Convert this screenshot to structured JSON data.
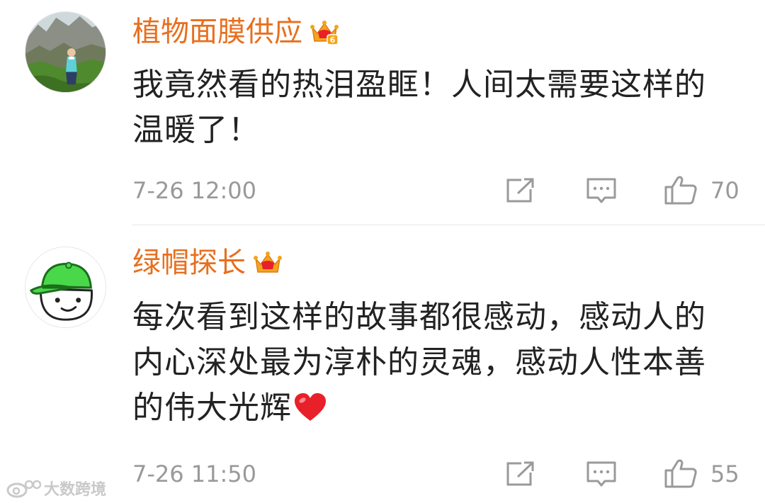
{
  "comments": [
    {
      "username": "植物面膜供应",
      "text": "我竟然看的热泪盈眶！人间太需要这样的温暖了！",
      "timestamp": "7-26 12:00",
      "likes": "70",
      "avatar_icon": "person-on-mountain-photo",
      "badge_icon": "vip-crown-level-6-icon",
      "badge_level": "6"
    },
    {
      "username": "绿帽探长",
      "text": "每次看到这样的故事都很感动，感动人的内心深处最为淳朴的灵魂，感动人性本善的伟大光辉",
      "trailing_emoji": "heart-icon",
      "timestamp": "7-26 11:50",
      "likes": "55",
      "avatar_icon": "green-cap-cartoon-avatar",
      "badge_icon": "vip-crown-icon"
    }
  ],
  "actions": {
    "share_icon": "share-icon",
    "reply_icon": "comment-icon",
    "like_icon": "thumbs-up-icon"
  },
  "watermark": {
    "text": "大数跨境"
  },
  "colors": {
    "username": "#e86f1e",
    "body_text": "#222222",
    "meta_text": "#999999",
    "heart": "#e8202a",
    "crown": "#f4a51c"
  }
}
